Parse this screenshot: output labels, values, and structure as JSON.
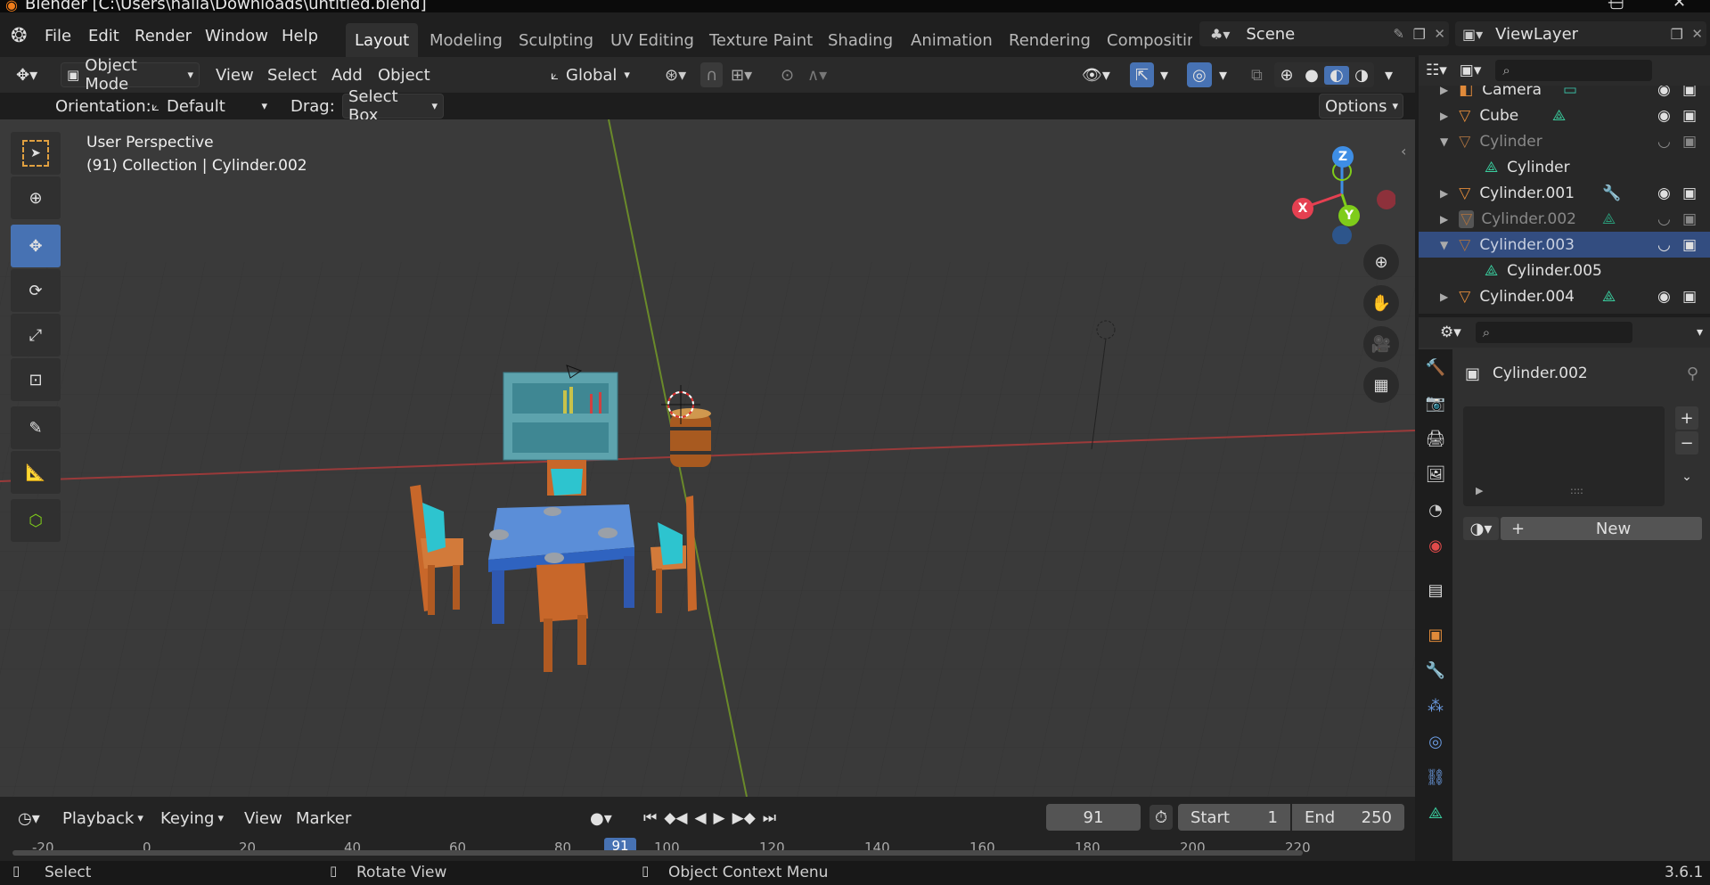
{
  "window": {
    "title": "Blender [C:\\Users\\naila\\Downloads\\untitled.blend]"
  },
  "menu": {
    "file": "File",
    "edit": "Edit",
    "render": "Render",
    "window": "Window",
    "help": "Help"
  },
  "workspace_tabs": [
    {
      "label": "Layout",
      "active": true
    },
    {
      "label": "Modeling"
    },
    {
      "label": "Sculpting"
    },
    {
      "label": "UV Editing"
    },
    {
      "label": "Texture Paint"
    },
    {
      "label": "Shading"
    },
    {
      "label": "Animation"
    },
    {
      "label": "Rendering"
    },
    {
      "label": "Compositin"
    }
  ],
  "scene": {
    "name": "Scene"
  },
  "view_layer": {
    "name": "ViewLayer"
  },
  "viewport_header": {
    "mode": "Object Mode",
    "view": "View",
    "select": "Select",
    "add": "Add",
    "object": "Object",
    "transform_orientation": "Global"
  },
  "tool_settings": {
    "orientation_label": "Orientation:",
    "orientation_value": "Default",
    "drag_label": "Drag:",
    "drag_value": "Select Box",
    "options": "Options"
  },
  "viewport": {
    "perspective": "User Perspective",
    "collection_info": "(91) Collection | Cylinder.002"
  },
  "gizmo": {
    "x": "X",
    "y": "Y",
    "z": "Z"
  },
  "outliner": {
    "items": [
      {
        "label": "Camera",
        "type": "camera",
        "dimmed": false
      },
      {
        "label": "Cube",
        "type": "mesh"
      },
      {
        "label": "Cylinder",
        "type": "mesh",
        "dimmed": true,
        "expanded": true
      },
      {
        "label": "Cylinder",
        "type": "mesh-data",
        "child": true
      },
      {
        "label": "Cylinder.001",
        "type": "mesh"
      },
      {
        "label": "Cylinder.002",
        "type": "mesh",
        "dimmed": true,
        "active": true
      },
      {
        "label": "Cylinder.003",
        "type": "mesh",
        "selected": true,
        "expanded": true
      },
      {
        "label": "Cylinder.005",
        "type": "mesh-data",
        "child": true
      },
      {
        "label": "Cylinder.004",
        "type": "mesh"
      }
    ]
  },
  "properties": {
    "object_name": "Cylinder.002",
    "new_button": "New"
  },
  "timeline": {
    "playback": "Playback",
    "keying": "Keying",
    "view": "View",
    "marker": "Marker",
    "current_frame": "91",
    "start_label": "Start",
    "start_value": "1",
    "end_label": "End",
    "end_value": "250",
    "ruler": [
      "-20",
      "0",
      "20",
      "40",
      "60",
      "80",
      "91",
      "100",
      "120",
      "140",
      "160",
      "180",
      "200",
      "220"
    ]
  },
  "statusbar": {
    "select": "Select",
    "rotate": "Rotate View",
    "context": "Object Context Menu",
    "version": "3.6.1"
  },
  "colors": {
    "accent": "#4772b3",
    "selected_row": "#334d80",
    "x_axis": "#e54051",
    "y_axis": "#7fcc1a",
    "z_axis": "#3e8ee5"
  }
}
